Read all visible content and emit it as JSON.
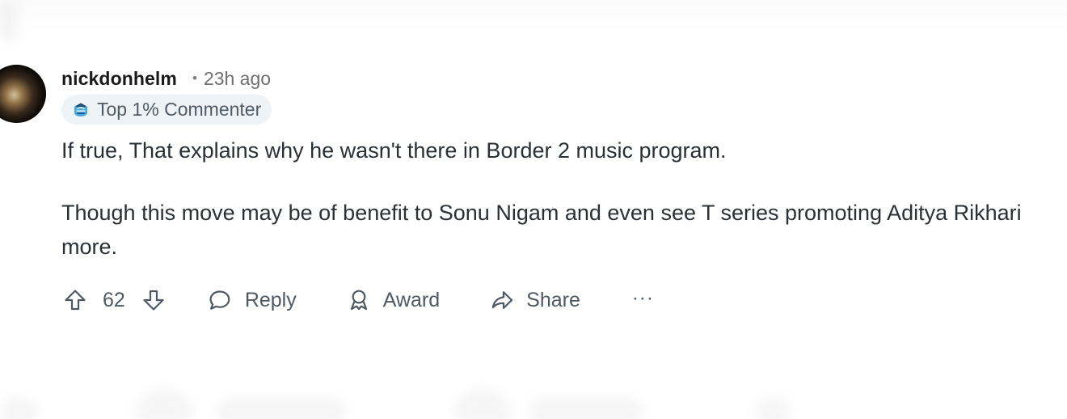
{
  "comment": {
    "author": "nickdonhelm",
    "separator": "•",
    "age": "23h ago",
    "badge": {
      "label": "Top 1% Commenter",
      "icon": "commenter-badge-icon"
    },
    "paragraphs": [
      "If true, That explains why he wasn't there in Border 2 music program.",
      "Though this move may be of benefit to Sonu Nigam and even see T series promoting Aditya Rikhari more."
    ],
    "score": "62",
    "actions": {
      "reply": "Reply",
      "award": "Award",
      "share": "Share",
      "more": "···"
    }
  },
  "colors": {
    "text": "#2a3036",
    "muted": "#6f6f6f",
    "badge_bg": "#eef3f7",
    "icon": "#4f5963"
  }
}
